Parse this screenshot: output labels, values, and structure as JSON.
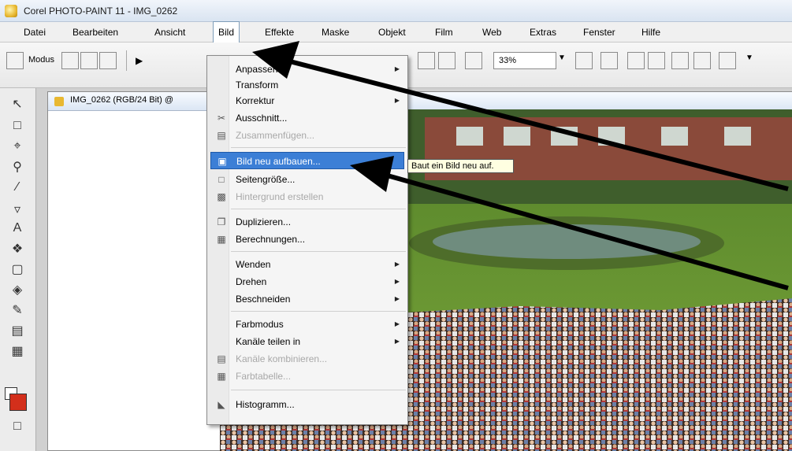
{
  "window": {
    "title": "Corel PHOTO-PAINT 11 - IMG_0262"
  },
  "menubar": [
    {
      "label": "Datei"
    },
    {
      "label": "Bearbeiten"
    },
    {
      "label": "Ansicht"
    },
    {
      "label": "Bild"
    },
    {
      "label": "Effekte"
    },
    {
      "label": "Maske"
    },
    {
      "label": "Objekt"
    },
    {
      "label": "Film"
    },
    {
      "label": "Web"
    },
    {
      "label": "Extras"
    },
    {
      "label": "Fenster"
    },
    {
      "label": "Hilfe"
    }
  ],
  "toolbar": {
    "mode_label": "Modus",
    "zoom_value": "33%"
  },
  "document": {
    "tab_title": "IMG_0262 (RGB/24 Bit) @"
  },
  "bild_menu": {
    "items": [
      {
        "label": "Anpassen",
        "submenu": true,
        "icon": ""
      },
      {
        "label": "Transform",
        "submenu": false,
        "icon": ""
      },
      {
        "label": "Korrektur",
        "submenu": true,
        "icon": ""
      },
      {
        "label": "Ausschnitt...",
        "submenu": false,
        "icon": "scissors-icon"
      },
      {
        "label": "Zusammenfügen...",
        "submenu": false,
        "disabled": true,
        "icon": "stitch-icon"
      },
      {
        "label": "Bild neu aufbauen...",
        "submenu": false,
        "highlighted": true,
        "icon": "resample-icon"
      },
      {
        "label": "Seitengröße...",
        "submenu": false,
        "icon": "paper-size-icon"
      },
      {
        "label": "Hintergrund erstellen",
        "submenu": false,
        "disabled": true,
        "icon": "background-icon"
      },
      {
        "label": "Duplizieren...",
        "submenu": false,
        "icon": "duplicate-icon"
      },
      {
        "label": "Berechnungen...",
        "submenu": false,
        "icon": "calculations-icon"
      },
      {
        "label": "Wenden",
        "submenu": true,
        "icon": ""
      },
      {
        "label": "Drehen",
        "submenu": true,
        "icon": ""
      },
      {
        "label": "Beschneiden",
        "submenu": true,
        "icon": ""
      },
      {
        "label": "Farbmodus",
        "submenu": true,
        "icon": ""
      },
      {
        "label": "Kanäle teilen in",
        "submenu": true,
        "icon": ""
      },
      {
        "label": "Kanäle kombinieren...",
        "submenu": false,
        "disabled": true,
        "icon": "combine-channels-icon"
      },
      {
        "label": "Farbtabelle...",
        "submenu": false,
        "disabled": true,
        "icon": "color-table-icon"
      },
      {
        "label": "Histogramm...",
        "submenu": false,
        "icon": "histogram-icon"
      }
    ]
  },
  "tooltip": {
    "text": "Baut ein Bild neu auf."
  },
  "colors": {
    "highlight": "#3c7fd6",
    "fill_swatch": "#d32f1b",
    "disabled_text": "#a8a8a8"
  }
}
